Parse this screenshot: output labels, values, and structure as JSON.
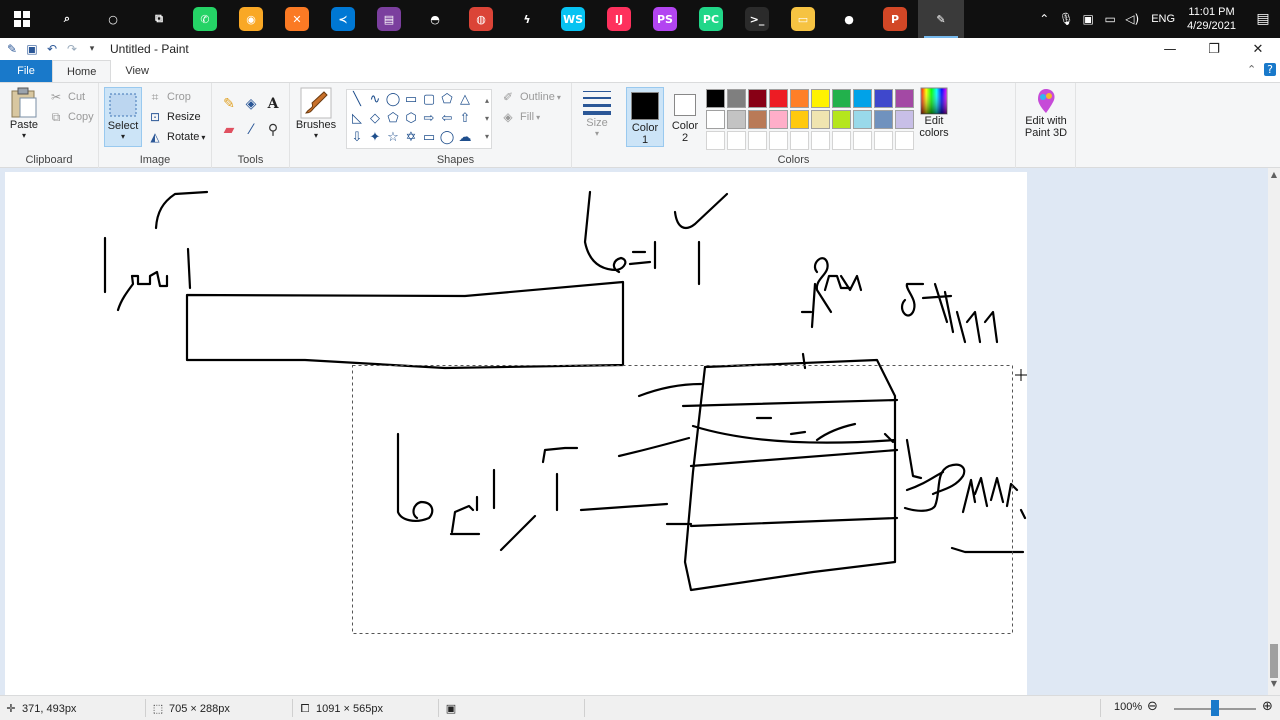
{
  "taskbar": {
    "apps": [
      {
        "icon": "search-icon",
        "glyph": "⌕",
        "color": "#101010"
      },
      {
        "icon": "cortana-icon",
        "glyph": "○",
        "color": "#101010"
      },
      {
        "icon": "task-view-icon",
        "glyph": "⧉",
        "color": "#101010"
      },
      {
        "icon": "whatsapp-icon",
        "glyph": "✆",
        "color": "#25d366"
      },
      {
        "icon": "chrome-canary-icon",
        "glyph": "◉",
        "color": "#f9a825"
      },
      {
        "icon": "xampp-icon",
        "glyph": "✕",
        "color": "#fb7a24"
      },
      {
        "icon": "vscode-icon",
        "glyph": "≺",
        "color": "#0078d4"
      },
      {
        "icon": "winrar-icon",
        "glyph": "▤",
        "color": "#7b3f9e"
      },
      {
        "icon": "mask-icon",
        "glyph": "◓",
        "color": "#101010"
      },
      {
        "icon": "chrome-icon",
        "glyph": "◍",
        "color": "#db4437"
      },
      {
        "icon": "flash-icon",
        "glyph": "ϟ",
        "color": "#101010"
      },
      {
        "icon": "webstorm-icon",
        "glyph": "WS",
        "color": "#07c3f2"
      },
      {
        "icon": "intellij-icon",
        "glyph": "IJ",
        "color": "#fe315d"
      },
      {
        "icon": "phpstorm-icon",
        "glyph": "PS",
        "color": "#b345f1"
      },
      {
        "icon": "pycharm-icon",
        "glyph": "PC",
        "color": "#21d789"
      },
      {
        "icon": "terminal-icon",
        "glyph": ">_",
        "color": "#2b2b2b"
      },
      {
        "icon": "file-explorer-icon",
        "glyph": "▭",
        "color": "#f6c342"
      },
      {
        "icon": "recorder-icon",
        "glyph": "●",
        "color": "#101010"
      },
      {
        "icon": "powerpoint-icon",
        "glyph": "P",
        "color": "#d24726"
      },
      {
        "icon": "paint-icon",
        "glyph": "✎",
        "color": "#3a3a3a"
      }
    ],
    "lang": "ENG",
    "time": "11:01 PM",
    "date": "4/29/2021"
  },
  "window": {
    "title": "Untitled - Paint",
    "minimize": "—",
    "restore": "❐",
    "close": "✕"
  },
  "tabs": {
    "file": "File",
    "home": "Home",
    "view": "View"
  },
  "ribbon": {
    "clipboard": {
      "label": "Clipboard",
      "paste": "Paste",
      "cut": "Cut",
      "copy": "Copy"
    },
    "image": {
      "label": "Image",
      "select": "Select",
      "crop": "Crop",
      "resize": "Resize",
      "rotate": "Rotate"
    },
    "tools": {
      "label": "Tools"
    },
    "brushes": {
      "label": "Brushes"
    },
    "shapes": {
      "label": "Shapes",
      "outline": "Outline",
      "fill": "Fill"
    },
    "size": {
      "label": "Size"
    },
    "colors": {
      "label": "Colors",
      "color1": "Color",
      "color1_num": "1",
      "color2": "Color",
      "color2_num": "2",
      "color1_value": "#000000",
      "color2_value": "#ffffff",
      "edit_colors": "Edit colors",
      "edit_3d": "Edit with Paint 3D",
      "palette_row1": [
        "#000000",
        "#7f7f7f",
        "#880015",
        "#ed1c24",
        "#ff7f27",
        "#fff200",
        "#22b14c",
        "#00a2e8",
        "#3f48cc",
        "#a349a4"
      ],
      "palette_row2": [
        "#ffffff",
        "#c3c3c3",
        "#b97a57",
        "#ffaec9",
        "#ffc90e",
        "#efe4b0",
        "#b5e61d",
        "#99d9ea",
        "#7092be",
        "#c8bfe7"
      ]
    }
  },
  "status": {
    "cursor": "371, 493px",
    "selection": "705 × 288px",
    "canvas_size": "1091 × 565px",
    "zoom": "100%",
    "zoom_level": 0.5
  }
}
